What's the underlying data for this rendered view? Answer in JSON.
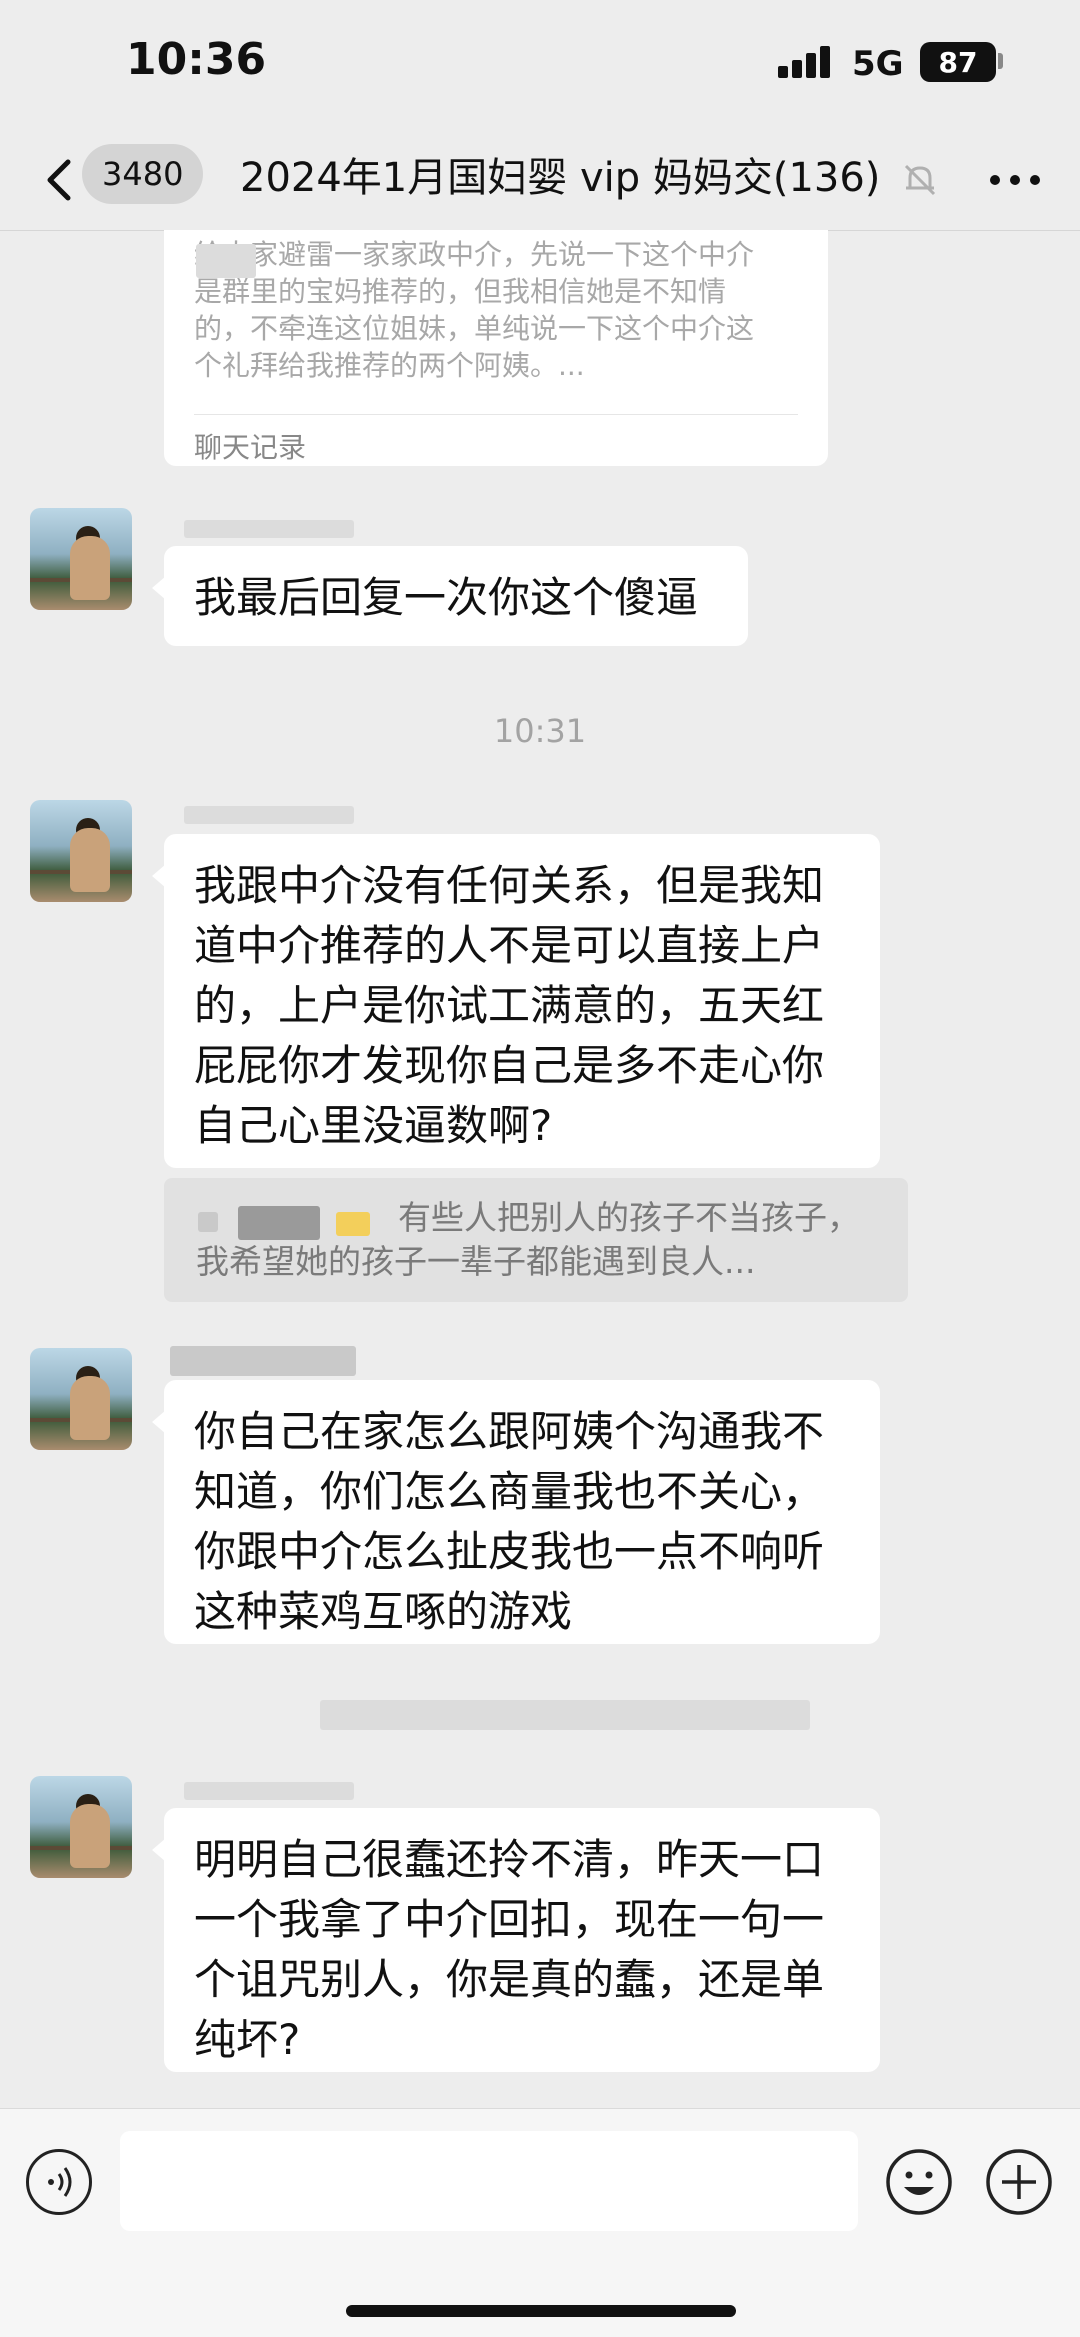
{
  "status_bar": {
    "time": "10:36",
    "network": "5G",
    "battery": "87"
  },
  "nav": {
    "unread_count": "3480",
    "title": "2024年1月国妇婴 vip 妈妈交(136)"
  },
  "chat_record_card": {
    "text": "给大家避雷一家家政中介，先说一下这个中介是群里的宝妈推荐的，但我相信她是不知情的，不牵连这位姐妹，单纯说一下这个中介这个礼拜给我推荐的两个阿姨。...",
    "label": "聊天记录"
  },
  "messages": [
    {
      "text": "我最后回复一次你这个傻逼"
    },
    {
      "text": "我跟中介没有任何关系，但是我知道中介推荐的人不是可以直接上户的，上户是你试工满意的，五天红屁屁你才发现你自己是多不走心你自己心里没逼数啊?"
    },
    {
      "text": "你自己在家怎么跟阿姨个沟通我不知道，你们怎么商量我也不关心，你跟中介怎么扯皮我也一点不响听这种菜鸡互啄的游戏"
    },
    {
      "text": "明明自己很蠢还拎不清，昨天一口一个我拿了中介回扣，现在一句一个诅咒别人，你是真的蠢，还是单纯坏?"
    }
  ],
  "time_separator": "10:31",
  "quote": {
    "text": "有些人把别人的孩子不当孩子，我希望她的孩子一辈子都能遇到良人..."
  },
  "input": {
    "value": ""
  },
  "icons": {
    "back": "chevron-left-icon",
    "mute": "bell-muted-icon",
    "more": "ellipsis-icon",
    "voice": "voice-icon",
    "emoji": "smiley-icon",
    "plus": "plus-icon"
  }
}
